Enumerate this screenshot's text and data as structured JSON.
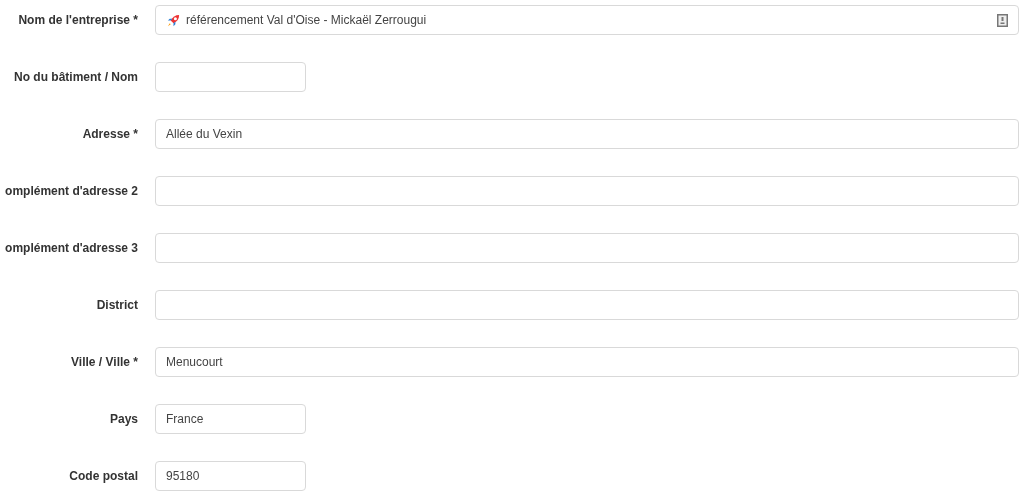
{
  "fields": [
    {
      "label": "Nom de l'entreprise *",
      "value": "référencement Val d'Oise - Mickaël Zerrougui",
      "kind": "decorated"
    },
    {
      "label": "No du bâtiment / Nom",
      "kind": "narrow"
    },
    {
      "label": "Adresse *",
      "value": "Allée du Vexin",
      "kind": "wide"
    },
    {
      "label": "omplément d'adresse 2",
      "kind": "wide"
    },
    {
      "label": "omplément d'adresse 3",
      "kind": "wide"
    },
    {
      "label": "District",
      "kind": "wide"
    },
    {
      "label": "Ville / Ville *",
      "value": "Menucourt",
      "kind": "wide"
    },
    {
      "label": "Pays",
      "value": "France",
      "kind": "narrow"
    },
    {
      "label": "Code postal",
      "value": "95180",
      "kind": "narrow"
    }
  ]
}
